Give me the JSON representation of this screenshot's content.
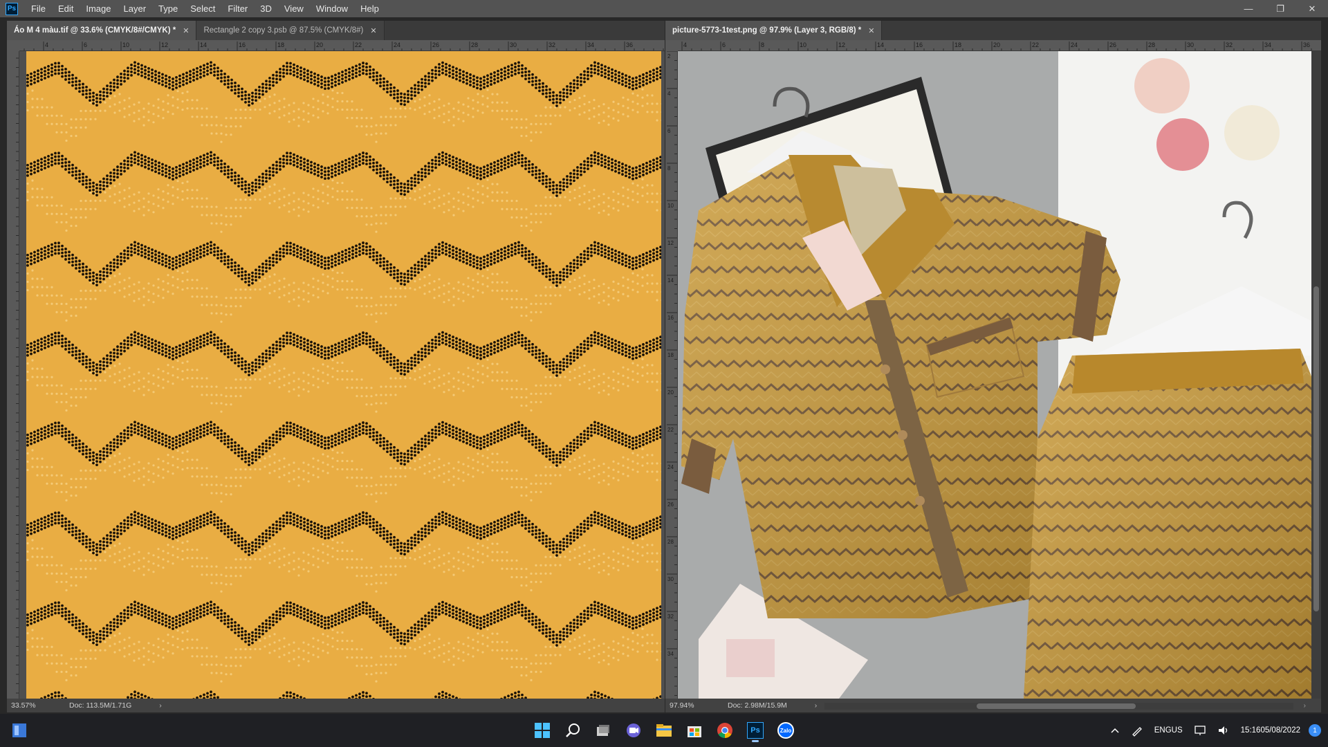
{
  "app": {
    "logo": "Ps",
    "menu": [
      "File",
      "Edit",
      "Image",
      "Layer",
      "Type",
      "Select",
      "Filter",
      "3D",
      "View",
      "Window",
      "Help"
    ],
    "window_controls": [
      "—",
      "❐",
      "✕"
    ]
  },
  "left_panel": {
    "tabs": [
      {
        "label": "Áo M 4 màu.tif @ 33.6% (CMYK/8#/CMYK) *",
        "close": "✕"
      },
      {
        "label": "Rectangle 2 copy 3.psb @ 87.5% (CMYK/8#)",
        "close": "✕"
      }
    ],
    "ruler_top": [
      "4",
      "6",
      "10",
      "12",
      "14",
      "16",
      "18",
      "20",
      "22",
      "24",
      "26",
      "28",
      "30",
      "32",
      "34",
      "36"
    ],
    "status": {
      "zoom": "33.57%",
      "doc": "Doc: 113.5M/1.71G",
      "arrow": "›"
    },
    "pattern": {
      "background": "#e9ad43",
      "dark_dots": "#1a1208",
      "light_dots": "#f6cf7f"
    }
  },
  "right_panel": {
    "tabs": [
      {
        "label": "picture-5773-1test.png @ 97.9% (Layer 3, RGB/8) *",
        "close": "✕"
      }
    ],
    "ruler_top": [
      "4",
      "6",
      "8",
      "10",
      "12",
      "14",
      "16",
      "18",
      "20",
      "22",
      "24",
      "26",
      "28",
      "30",
      "32",
      "34",
      "36"
    ],
    "ruler_left": [
      "2",
      "4",
      "6",
      "8",
      "10",
      "12",
      "14",
      "16",
      "18",
      "20",
      "22",
      "24",
      "26",
      "28",
      "30",
      "32",
      "34"
    ],
    "status": {
      "zoom": "97.94%",
      "doc": "Doc: 2.98M/15.9M",
      "arrow": "›",
      "scroll_left": "‹",
      "scroll_right": "›"
    }
  },
  "taskbar": {
    "apps": [
      "start-icon",
      "search-icon",
      "task-view-icon",
      "teams-icon",
      "file-explorer-icon",
      "store-icon",
      "chrome-icon",
      "photoshop-icon",
      "zalo-icon"
    ],
    "zalo_label": "Zalo",
    "ps_label": "Ps",
    "lang_top": "ENG",
    "lang_bottom": "US",
    "time": "15:16",
    "date": "05/08/2022",
    "notification_count": "1"
  }
}
